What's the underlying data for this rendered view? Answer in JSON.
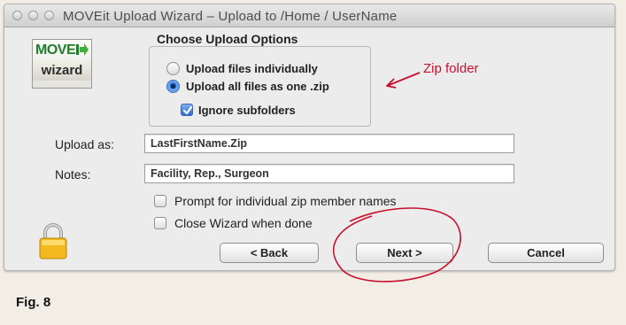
{
  "window": {
    "title": "MOVEit Upload Wizard – Upload to /Home / UserName"
  },
  "logo": {
    "top_text": "MOVE",
    "bottom_text": "wizard"
  },
  "upload_options": {
    "group_title": "Choose Upload Options",
    "options": [
      {
        "label": "Upload files individually",
        "selected": false
      },
      {
        "label": "Upload all files as one .zip",
        "selected": true
      }
    ],
    "ignore_subfolders": {
      "label": "Ignore subfolders",
      "checked": true
    }
  },
  "fields": {
    "upload_as": {
      "label": "Upload as:",
      "value": "LastFirstName.Zip"
    },
    "notes": {
      "label": "Notes:",
      "value": "Facility, Rep., Surgeon"
    }
  },
  "checkboxes": [
    {
      "label": "Prompt for individual zip member names",
      "checked": false
    },
    {
      "label": "Close Wizard when done",
      "checked": false
    }
  ],
  "buttons": {
    "back": "< Back",
    "next": "Next >",
    "cancel": "Cancel"
  },
  "annotation": {
    "text": "Zip folder",
    "color": "#c8102e"
  },
  "caption": "Fig. 8",
  "colors": {
    "logo_green": "#1f7d2d",
    "selection_blue": "#2d6ad3",
    "annotation_red": "#c8102e"
  }
}
